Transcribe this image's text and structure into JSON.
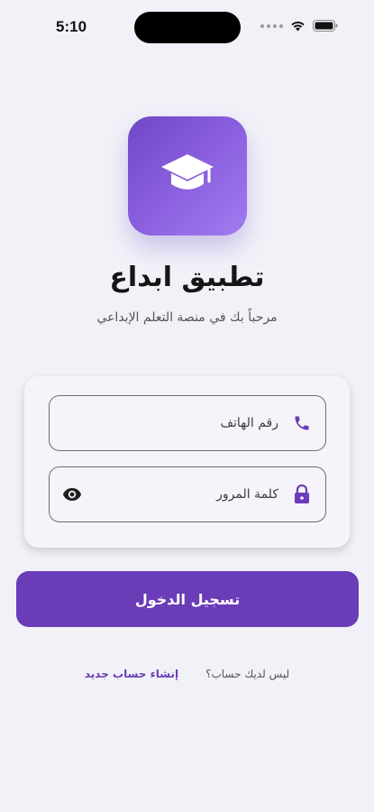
{
  "status_bar": {
    "time": "5:10"
  },
  "app": {
    "title": "تطبيق ابداع",
    "subtitle": "مرحباً بك في منصة التعلم الإبداعي",
    "logo_icon": "graduation-cap-icon"
  },
  "form": {
    "phone_placeholder": "رقم الهاتف",
    "password_placeholder": "كلمة المرور"
  },
  "login_button": {
    "label": "تسجيل الدخول"
  },
  "signup": {
    "prompt": "ليس لديك حساب؟",
    "link": "إنشاء حساب جديد"
  },
  "colors": {
    "accent": "#6a3cb8",
    "background": "#f1f2f8",
    "card": "#f7f3fa"
  }
}
